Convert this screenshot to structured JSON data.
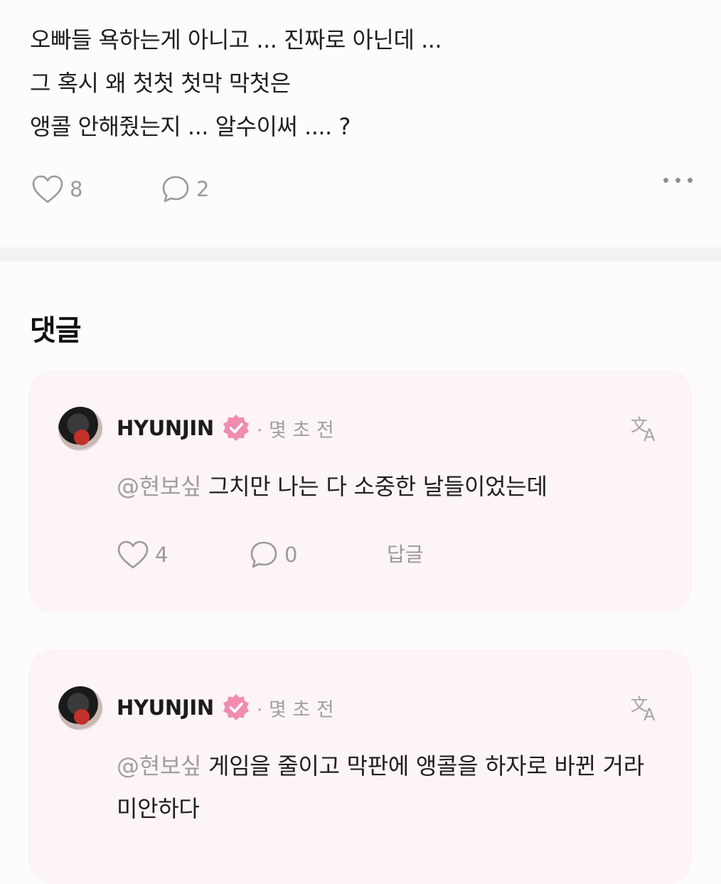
{
  "post": {
    "lines": [
      "오빠들 욕하는게 아니고 ... 진짜로 아닌데 ...",
      "그 혹시 왜 첫첫 첫막 막첫은",
      "앵콜 안해줬는지 ... 알수이써 .... ?"
    ],
    "like_count": "8",
    "comment_count": "2"
  },
  "comments_section": {
    "title": "댓글"
  },
  "comments": [
    {
      "author": "HYUNJIN",
      "time": "· 몇 초 전",
      "mention": "@현보싶",
      "text": "그치만 나는 다 소중한 날들이었는데",
      "like_count": "4",
      "reply_count": "0",
      "reply_label": "답글"
    },
    {
      "author": "HYUNJIN",
      "time": "· 몇 초 전",
      "mention": "@현보싶",
      "text": "게임을 줄이고 막판에 앵콜을 하자로 바뀐 거라 미안하다"
    }
  ],
  "colors": {
    "card_bg": "#fcf4f6",
    "verified_badge": "#f08cb0",
    "muted_text": "#9a9a9e"
  },
  "icons": [
    "heart-icon",
    "comment-icon",
    "more-icon",
    "verified-badge-icon",
    "translate-icon"
  ]
}
